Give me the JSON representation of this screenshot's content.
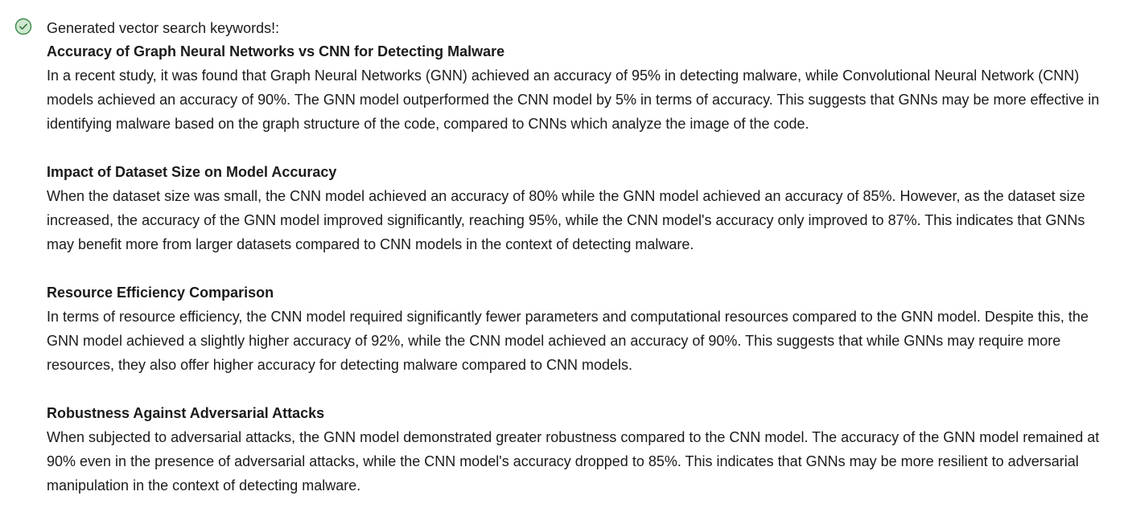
{
  "status": {
    "text": "Generated vector search keywords!:",
    "icon": "check-circle-icon",
    "icon_color": "#3a8a4a",
    "icon_fill": "#cfe8cf"
  },
  "sections": [
    {
      "title": "Accuracy of Graph Neural Networks vs CNN for Detecting Malware",
      "body": "In a recent study, it was found that Graph Neural Networks (GNN) achieved an accuracy of 95% in detecting malware, while Convolutional Neural Network (CNN) models achieved an accuracy of 90%. The GNN model outperformed the CNN model by 5% in terms of accuracy. This suggests that GNNs may be more effective in identifying malware based on the graph structure of the code, compared to CNNs which analyze the image of the code."
    },
    {
      "title": "Impact of Dataset Size on Model Accuracy",
      "body": "When the dataset size was small, the CNN model achieved an accuracy of 80% while the GNN model achieved an accuracy of 85%. However, as the dataset size increased, the accuracy of the GNN model improved significantly, reaching 95%, while the CNN model's accuracy only improved to 87%. This indicates that GNNs may benefit more from larger datasets compared to CNN models in the context of detecting malware."
    },
    {
      "title": "Resource Efficiency Comparison",
      "body": "In terms of resource efficiency, the CNN model required significantly fewer parameters and computational resources compared to the GNN model. Despite this, the GNN model achieved a slightly higher accuracy of 92%, while the CNN model achieved an accuracy of 90%. This suggests that while GNNs may require more resources, they also offer higher accuracy for detecting malware compared to CNN models."
    },
    {
      "title": "Robustness Against Adversarial Attacks",
      "body": "When subjected to adversarial attacks, the GNN model demonstrated greater robustness compared to the CNN model. The accuracy of the GNN model remained at 90% even in the presence of adversarial attacks, while the CNN model's accuracy dropped to 85%. This indicates that GNNs may be more resilient to adversarial manipulation in the context of detecting malware."
    }
  ]
}
